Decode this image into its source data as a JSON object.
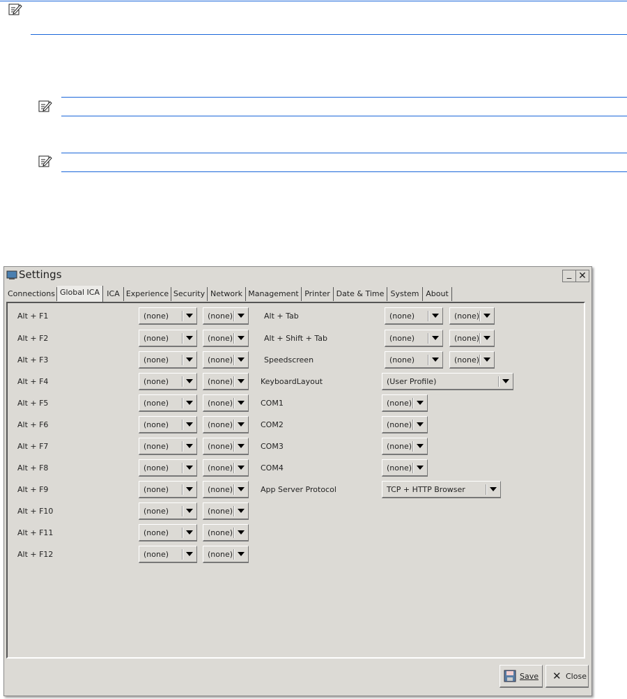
{
  "notes": [
    {
      "icon": "note-icon"
    },
    {
      "icon": "note-icon"
    },
    {
      "icon": "note-icon"
    }
  ],
  "window": {
    "title": "Settings",
    "icon": "settings-app-icon",
    "tabs": [
      "Connections",
      "Global ICA",
      "ICA",
      "Experience",
      "Security",
      "Network",
      "Management",
      "Printer",
      "Date & Time",
      "System",
      "About"
    ],
    "selected_tab": "Global ICA",
    "left_rows": [
      {
        "label": "Alt + F1",
        "a": "(none)",
        "b": "(none)"
      },
      {
        "label": "Alt + F2",
        "a": "(none)",
        "b": "(none)"
      },
      {
        "label": "Alt + F3",
        "a": "(none)",
        "b": "(none)"
      },
      {
        "label": "Alt + F4",
        "a": "(none)",
        "b": "(none)"
      },
      {
        "label": "Alt + F5",
        "a": "(none)",
        "b": "(none)"
      },
      {
        "label": "Alt + F6",
        "a": "(none)",
        "b": "(none)"
      },
      {
        "label": "Alt + F7",
        "a": "(none)",
        "b": "(none)"
      },
      {
        "label": "Alt + F8",
        "a": "(none)",
        "b": "(none)"
      },
      {
        "label": "Alt + F9",
        "a": "(none)",
        "b": "(none)"
      },
      {
        "label": "Alt + F10",
        "a": "(none)",
        "b": "(none)"
      },
      {
        "label": "Alt + F11",
        "a": "(none)",
        "b": "(none)"
      },
      {
        "label": "Alt + F12",
        "a": "(none)",
        "b": "(none)"
      }
    ],
    "right_rows": [
      {
        "label": "Alt + Tab",
        "a": "(none)",
        "b": "(none)"
      },
      {
        "label": "Alt + Shift + Tab",
        "a": "(none)",
        "b": "(none)"
      },
      {
        "label": "Speedscreen",
        "a": "(none)",
        "b": "(none)"
      },
      {
        "label": "KeyboardLayout",
        "a": "(User Profile)"
      },
      {
        "label": "COM1",
        "a": "(none)"
      },
      {
        "label": "COM2",
        "a": "(none)"
      },
      {
        "label": "COM3",
        "a": "(none)"
      },
      {
        "label": "COM4",
        "a": "(none)"
      },
      {
        "label": "App Server Protocol",
        "a": "TCP + HTTP Browser"
      }
    ],
    "save_label": "Save",
    "close_label": "Close"
  }
}
